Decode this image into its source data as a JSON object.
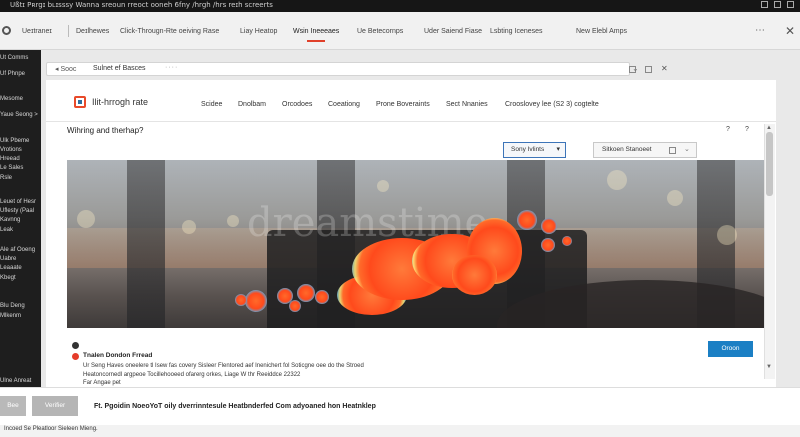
{
  "os": {
    "title": "Ußtɪ Pʀrgɪ bʟɪsssy   Wanna sreoun rreoct ooneh   6fny /hrgh /hrs reɪh screerts"
  },
  "browser": {
    "brand": "Ueɪtraneɪ",
    "tabs": [
      {
        "label": "Deɪlhewes"
      },
      {
        "label": "Click-Througn-Rte oeiving Rase"
      },
      {
        "label": "Liay Heatop"
      },
      {
        "label": "Wsin Ineeeaes"
      },
      {
        "label": "Ue Betecornps"
      },
      {
        "label": "Uder Saiend Fiase"
      },
      {
        "label": "Lsbting Iceneses"
      },
      {
        "label": "New Elebl Amps"
      }
    ],
    "tab_menu_icon": "dots-icon",
    "tab_close_icon": "close-icon",
    "address": {
      "nav": "◂ Sooc",
      "text": "Sulnet ef Basces",
      "dots": "····"
    }
  },
  "sidebar": {
    "items": [
      {
        "label": "Ut Comms"
      },
      {
        "label": "Uf Phnpe"
      },
      {
        "label": "Mesome"
      },
      {
        "label": "Yaue Seong >"
      },
      {
        "label": "Ulk Pbeme"
      },
      {
        "label": "Vrotions"
      },
      {
        "label": "Hreead"
      },
      {
        "label": "Le Sales"
      },
      {
        "label": "Rsle"
      },
      {
        "label": "Leuet of Hesr"
      },
      {
        "label": "Uflesty (Paal"
      },
      {
        "label": "Kavnng"
      },
      {
        "label": "Leak"
      },
      {
        "label": "Ale af Ooeng"
      },
      {
        "label": "Uabre"
      },
      {
        "label": "Leaaate"
      },
      {
        "label": "Kbegt"
      },
      {
        "label": "Blu Deng"
      },
      {
        "label": "Mlkenm"
      },
      {
        "label": "Ulne Anreat"
      }
    ]
  },
  "site": {
    "name": "Ilit-hrrogh rate",
    "nav": [
      {
        "label": "Scidee"
      },
      {
        "label": "Dnolbam"
      },
      {
        "label": "Orcodoes"
      },
      {
        "label": "Coeationg"
      },
      {
        "label": "Prone Boveraints"
      },
      {
        "label": "Sect Nnanies"
      },
      {
        "label": "Crooslovey lee (S2 3) cogtelte"
      }
    ]
  },
  "section": {
    "title": "Wihring and therhap?",
    "select_label": "Sony Ivlints",
    "second_label": "Sitkoen Stanoeet",
    "help_icon": "question-icon"
  },
  "heatmap": {
    "watermark": "dreamstime"
  },
  "info": {
    "title": "Tnalen Dondon Frread",
    "lines": [
      "Ur Seng Haves oneelere tl Isew fas covery Sisleer Flentored aef Inenichert fol Soticgne oee do the Stroed",
      "Heatoncornedl argpeoe Tocillehooeed ofarerg orkes, Liage W thr Reeiddce 22322",
      "Far Angae pet"
    ],
    "button": "Oroon"
  },
  "bottom": {
    "back": "Bee",
    "verify": "Verifier",
    "message": "Ft. Pgoidin NoeoYoT oily dverrinntesule Heatbnderfed Com adyoaned hon Heatnklep",
    "status": "Incoed Se Pleatloor Sieleen Mieng."
  },
  "colors": {
    "accent_orange": "#e84a2a",
    "button_blue": "#1b7fc4",
    "sidebar_bg": "#1e1e1e"
  }
}
